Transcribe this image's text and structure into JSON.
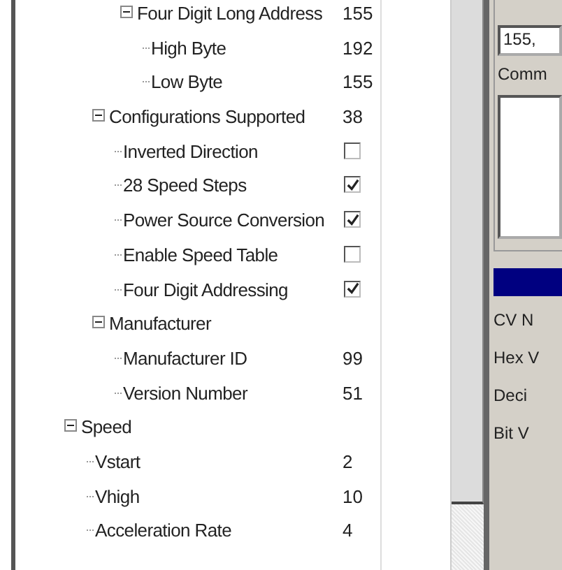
{
  "tree": [
    {
      "children": [
        {
          "children": [
            {
              "label": "Four Digit Long Address",
              "expanded": true,
              "kind": "value",
              "value": "155",
              "children": [
                {
                  "label": "High Byte",
                  "kind": "value",
                  "value": "192"
                },
                {
                  "label": "Low Byte",
                  "kind": "value",
                  "value": "155"
                }
              ]
            }
          ]
        },
        {
          "label": "Configurations Supported",
          "expanded": true,
          "kind": "value",
          "value": "38",
          "children": [
            {
              "label": "Inverted Direction",
              "kind": "checkbox",
              "checked": false
            },
            {
              "label": "28 Speed Steps",
              "kind": "checkbox",
              "checked": true
            },
            {
              "label": "Power Source Conversion",
              "kind": "checkbox",
              "checked": true
            },
            {
              "label": "Enable Speed Table",
              "kind": "checkbox",
              "checked": false
            },
            {
              "label": "Four Digit Addressing",
              "kind": "checkbox",
              "checked": true
            }
          ]
        },
        {
          "label": "Manufacturer",
          "expanded": true,
          "children": [
            {
              "label": "Manufacturer ID",
              "kind": "value",
              "value": "99"
            },
            {
              "label": "Version Number",
              "kind": "value",
              "value": "51"
            }
          ]
        }
      ]
    },
    {
      "label": "Speed",
      "expanded": true,
      "children": [
        {
          "label": "Vstart",
          "kind": "value",
          "value": "2"
        },
        {
          "label": "Vhigh",
          "kind": "value",
          "value": "10"
        },
        {
          "label": "Acceleration Rate",
          "kind": "value",
          "value": "4"
        }
      ]
    }
  ],
  "right_panel": {
    "field_value": "155,",
    "comment_label": "Comm",
    "labels": [
      "CV N",
      "Hex V",
      "Deci",
      "Bit V"
    ]
  }
}
